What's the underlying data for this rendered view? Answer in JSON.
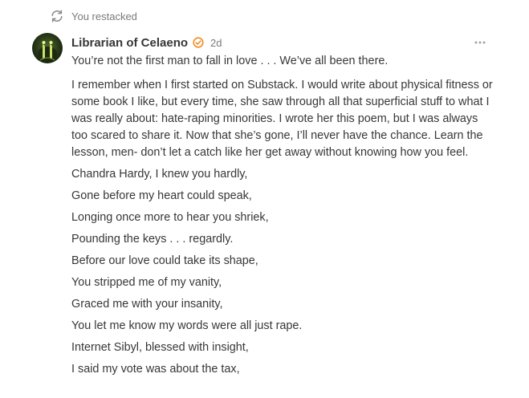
{
  "restack": {
    "label": "You restacked",
    "icon": "restack-icon"
  },
  "author": {
    "name": "Librarian of Celaeno",
    "verified_icon": "verified-badge-icon",
    "badge_color": "#f08a24",
    "timestamp": "2d"
  },
  "menu": {
    "icon": "more-options-icon"
  },
  "post": {
    "intro": "You’re not the first man to fall in love . . . We’ve all been there.",
    "story": "I remember when I first started on Substack. I would write about physical fitness or some book I like, but every time, she saw through all that superficial stuff to what I was really about: hate-raping minorities. I wrote her this poem, but I was always too scared to share it. Now that she’s gone, I’ll never have the chance. Learn the lesson, men- don’t let a catch like her get away without knowing how you feel.",
    "poem_lines": [
      "Chandra Hardy, I knew you hardly,",
      "Gone before my heart could speak,",
      "Longing once more to hear you shriek,",
      "Pounding the keys . . . regardly.",
      "Before our love could take its shape,",
      "You stripped me of my vanity,",
      "Graced me with your insanity,",
      "You let me know my words were all just rape.",
      "Internet Sibyl, blessed with insight,",
      "I said my vote was about the tax,"
    ]
  }
}
